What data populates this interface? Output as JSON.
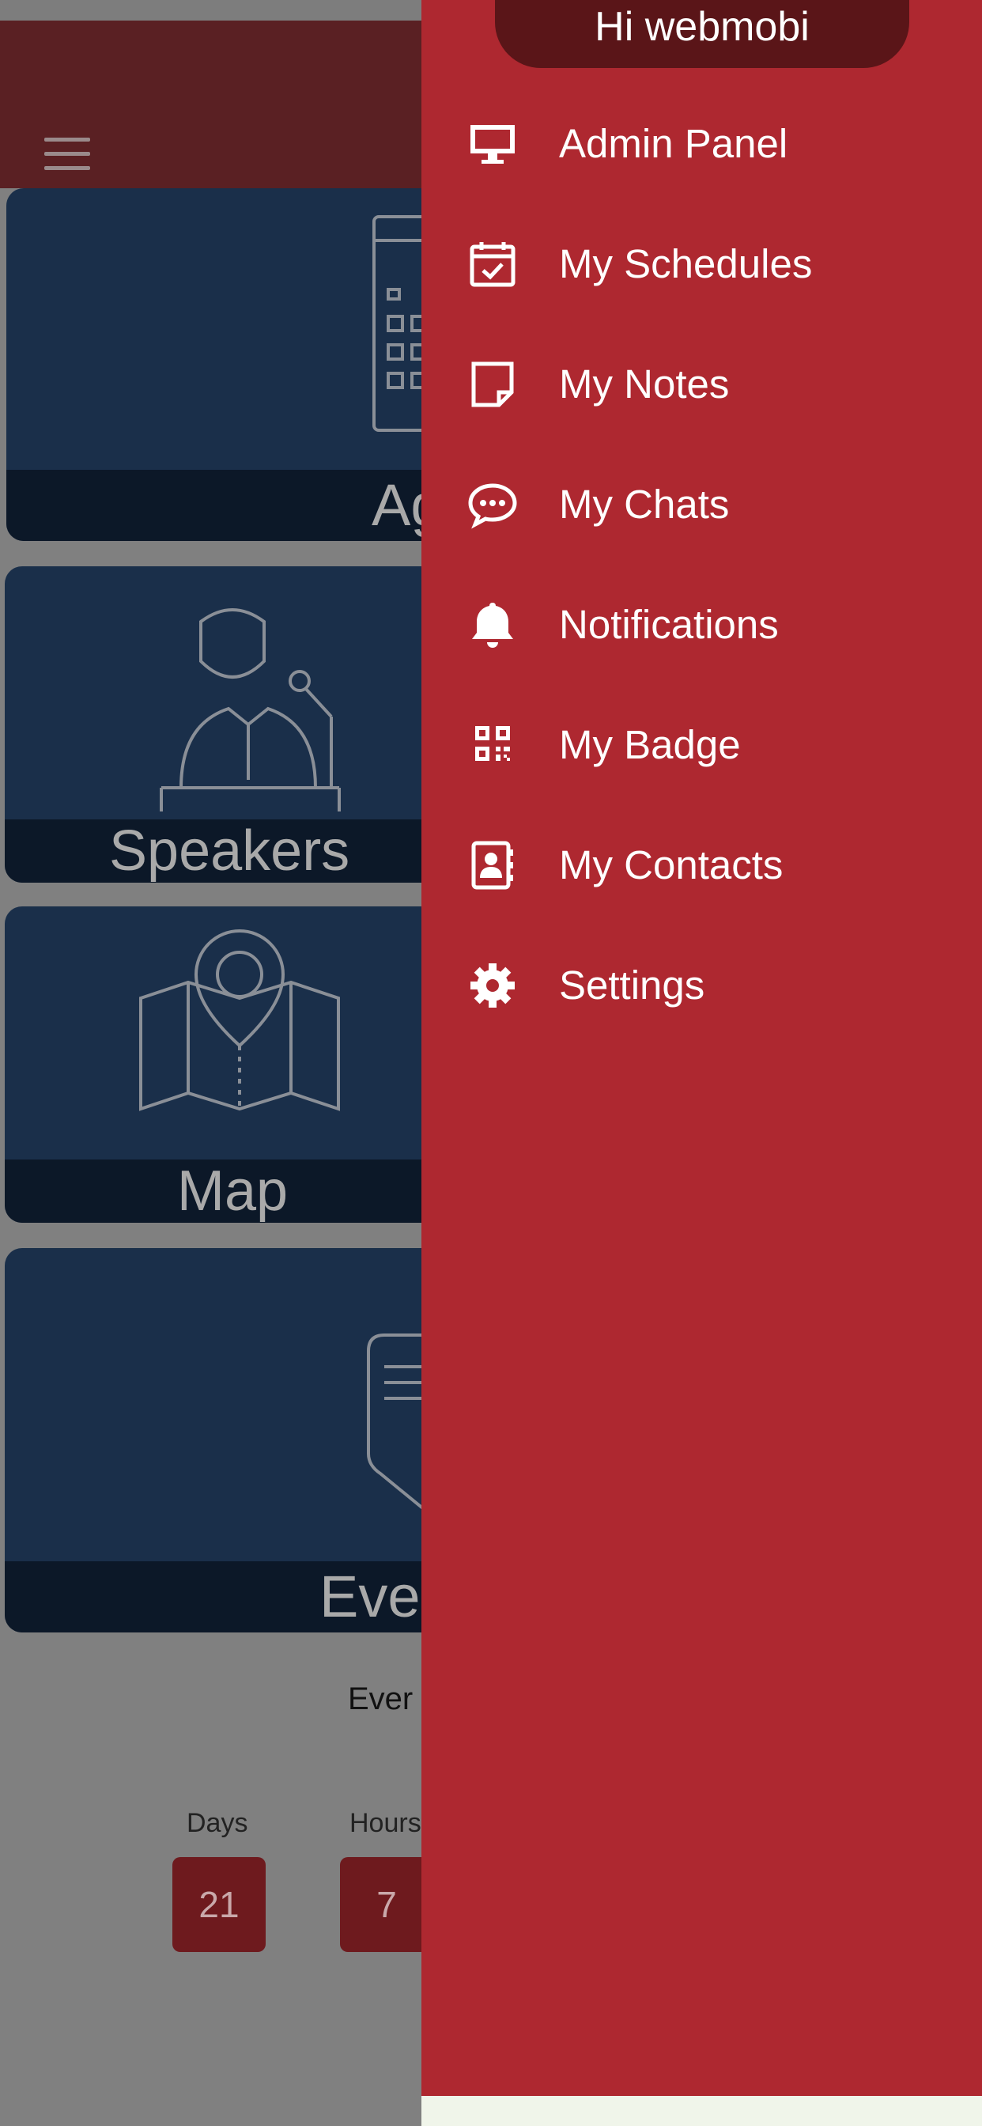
{
  "drawer": {
    "greeting": "Hi webmobi",
    "items": [
      {
        "label": "Admin Panel",
        "icon": "monitor-icon"
      },
      {
        "label": "My Schedules",
        "icon": "calendar-check-icon"
      },
      {
        "label": "My Notes",
        "icon": "note-icon"
      },
      {
        "label": "My Chats",
        "icon": "chat-bubble-icon"
      },
      {
        "label": "Notifications",
        "icon": "bell-icon"
      },
      {
        "label": "My Badge",
        "icon": "qr-code-icon"
      },
      {
        "label": "My Contacts",
        "icon": "contact-book-icon"
      },
      {
        "label": "Settings",
        "icon": "gear-icon"
      }
    ]
  },
  "tiles": {
    "agenda": "Ag",
    "speakers": "Speakers",
    "map": "Map",
    "event": "Eve"
  },
  "countdown": {
    "title": "Ever",
    "days_label": "Days",
    "days_value": "21",
    "hours_label": "Hours",
    "hours_value": "7"
  },
  "colors": {
    "drawer_bg": "#ae2830",
    "greeting_bg": "#5a1518",
    "topbar_bg": "#5a2023",
    "tile_bg": "#1a2f4a",
    "overlay_bg": "#808080"
  }
}
